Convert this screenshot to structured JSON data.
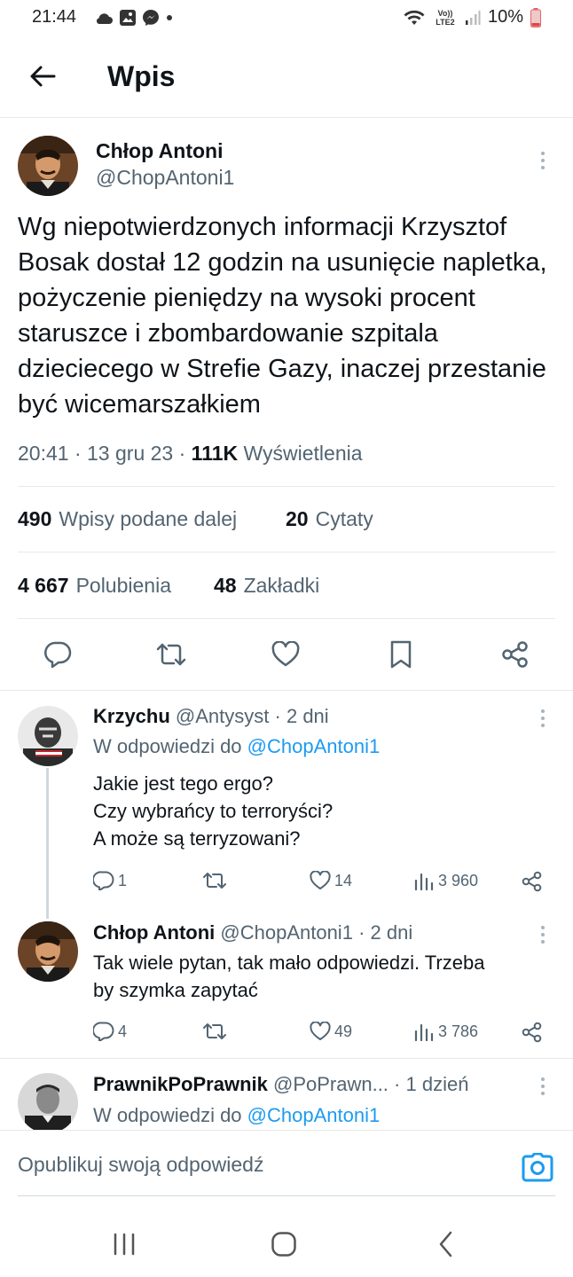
{
  "status_bar": {
    "time": "21:44",
    "network_label": "Vo)) LTE2",
    "battery": "10%"
  },
  "header": {
    "title": "Wpis"
  },
  "tweet": {
    "author_name": "Chłop Antoni",
    "author_handle": "@ChopAntoni1",
    "text": "Wg niepotwierdzonych informacji Krzysztof Bosak dostał 12 godzin na usunięcie napletka, pożyczenie pieniędzy na wysoki procent staruszce i zbombardowanie szpitala dzieciecego w Strefie Gazy, inaczej przestanie być wicemarszałkiem",
    "time": "20:41",
    "date": "13 gru 23",
    "views_count": "111K",
    "views_label": "Wyświetlenia",
    "retweets_count": "490",
    "retweets_label": "Wpisy podane dalej",
    "quotes_count": "20",
    "quotes_label": "Cytaty",
    "likes_count": "4 667",
    "likes_label": "Polubienia",
    "bookmarks_count": "48",
    "bookmarks_label": "Zakładki"
  },
  "replies": [
    {
      "name": "Krzychu",
      "handle": "@Antysyst",
      "age": "2 dni",
      "reply_to_prefix": "W odpowiedzi do",
      "reply_to_handle": "@ChopAntoni1",
      "lines": [
        "Jakie jest tego ergo?",
        "Czy wybrańcy to terroryści?",
        "A może są terryzowani?"
      ],
      "replies": "1",
      "retweets": "",
      "likes": "14",
      "views": "3 960"
    },
    {
      "name": "Chłop Antoni",
      "handle": "@ChopAntoni1",
      "age": "2 dni",
      "lines": [
        "Tak wiele pytan, tak mało odpowiedzi. Trzeba",
        "by szymka zapytać"
      ],
      "replies": "4",
      "retweets": "",
      "likes": "49",
      "views": "3 786"
    },
    {
      "name": "PrawnikPoPrawnik",
      "handle": "@PoPrawn...",
      "age": "1 dzień",
      "reply_to_prefix": "W odpowiedzi do",
      "reply_to_handle": "@ChopAntoni1"
    }
  ],
  "composer": {
    "placeholder": "Opublikuj swoją odpowiedź"
  },
  "colors": {
    "accent": "#1d9bf0",
    "secondary_text": "#536471",
    "primary_text": "#0f1419",
    "divider": "#e6e9eb"
  },
  "icons": [
    "cloud-icon",
    "gallery-icon",
    "messenger-icon",
    "wifi-icon",
    "signal-icon",
    "battery-icon",
    "back-arrow-icon",
    "more-icon",
    "reply-icon",
    "retweet-icon",
    "like-icon",
    "bookmark-icon",
    "share-icon",
    "views-icon",
    "camera-icon",
    "recent-apps-icon",
    "home-icon",
    "back-nav-icon"
  ]
}
